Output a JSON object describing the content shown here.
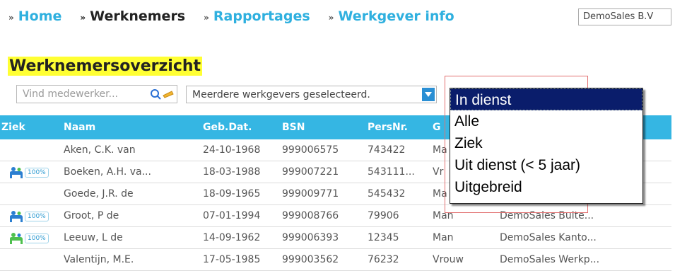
{
  "nav": {
    "arrow": "»",
    "items": [
      {
        "label": "Home",
        "active": false
      },
      {
        "label": "Werknemers",
        "active": true
      },
      {
        "label": "Rapportages",
        "active": false
      },
      {
        "label": "Werkgever info",
        "active": false
      }
    ],
    "company": "DemoSales B.V"
  },
  "page": {
    "title": "Werknemersoverzicht"
  },
  "search": {
    "placeholder": "Vind medewerker...",
    "icon": "search-icon"
  },
  "employer_select": {
    "value": "Meerdere werkgevers geselecteerd."
  },
  "table": {
    "headers": [
      "Ziek",
      "Naam",
      "Geb.Dat.",
      "BSN",
      "PersNr.",
      "G"
    ],
    "rows": [
      {
        "ziek": "",
        "naam": "Aken, C.K. van",
        "geb": "24-10-1968",
        "bsn": "999006575",
        "pers": "743422",
        "geslacht": "Ma",
        "werkgever": ""
      },
      {
        "ziek": "100%",
        "naam": "Boeken, A.H. va...",
        "geb": "18-03-1988",
        "bsn": "999007221",
        "pers": "543111...",
        "geslacht": "Vr",
        "werkgever": ""
      },
      {
        "ziek": "",
        "naam": "Goede, J.R. de",
        "geb": "18-09-1965",
        "bsn": "999009771",
        "pers": "545432",
        "geslacht": "Ma",
        "werkgever": ""
      },
      {
        "ziek": "100%",
        "naam": "Groot, P de",
        "geb": "07-01-1994",
        "bsn": "999008766",
        "pers": "79906",
        "geslacht": "Man",
        "werkgever": "DemoSales Buite..."
      },
      {
        "ziek": "100%",
        "naam": "Leeuw, L de",
        "geb": "14-09-1962",
        "bsn": "999006393",
        "pers": "12345",
        "geslacht": "Man",
        "werkgever": "DemoSales Kanto..."
      },
      {
        "ziek": "",
        "naam": "Valentijn, M.E.",
        "geb": "17-05-1985",
        "bsn": "999003562",
        "pers": "76232",
        "geslacht": "Vrouw",
        "werkgever": "DemoSales Werkp..."
      }
    ]
  },
  "status_dropdown": {
    "selected": "In dienst",
    "options": [
      "In dienst",
      "Alle",
      "Ziek",
      "Uit dienst (< 5 jaar)",
      "Uitgebreid"
    ]
  },
  "colors": {
    "accent": "#35b6e3",
    "title_highlight": "#ffff33",
    "dropdown_selected": "#0a1d6b",
    "focus_frame": "#e27070"
  }
}
